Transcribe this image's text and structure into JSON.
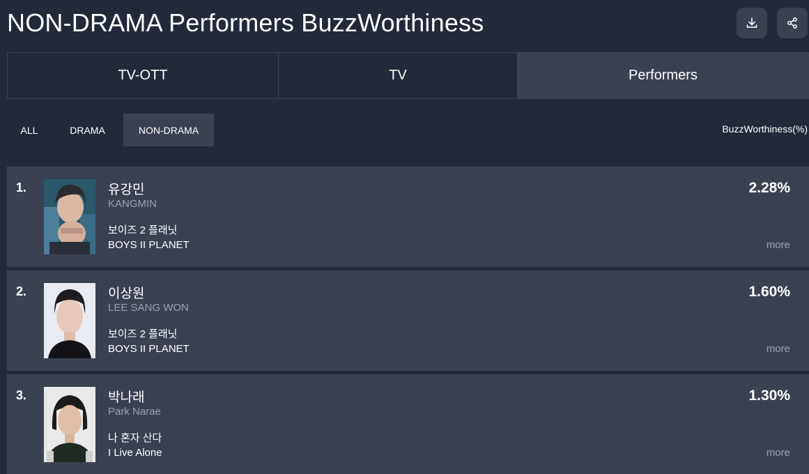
{
  "header": {
    "title": "NON-DRAMA Performers BuzzWorthiness",
    "download_icon": "download-icon",
    "share_icon": "share-icon"
  },
  "main_tabs": [
    {
      "label": "TV-OTT",
      "active": false
    },
    {
      "label": "TV",
      "active": false
    },
    {
      "label": "Performers",
      "active": true
    }
  ],
  "sub_tabs": [
    {
      "label": "ALL",
      "active": false
    },
    {
      "label": "DRAMA",
      "active": false
    },
    {
      "label": "NON-DRAMA",
      "active": true
    }
  ],
  "metric_label": "BuzzWorthiness(%)",
  "performers": [
    {
      "rank": "1.",
      "name_ko": "유강민",
      "name_en": "KANGMIN",
      "show_ko": "보이즈 2 플래닛",
      "show_en": "BOYS II PLANET",
      "value": "2.28%",
      "more": "more",
      "photo": "performer-photo"
    },
    {
      "rank": "2.",
      "name_ko": "이상원",
      "name_en": "LEE SANG WON",
      "show_ko": "보이즈 2 플래닛",
      "show_en": "BOYS II PLANET",
      "value": "1.60%",
      "more": "more",
      "photo": "performer-photo"
    },
    {
      "rank": "3.",
      "name_ko": "박나래",
      "name_en": "Park Narae",
      "show_ko": "나 혼자 산다",
      "show_en": "I Live Alone",
      "value": "1.30%",
      "more": "more",
      "photo": "performer-photo"
    }
  ]
}
